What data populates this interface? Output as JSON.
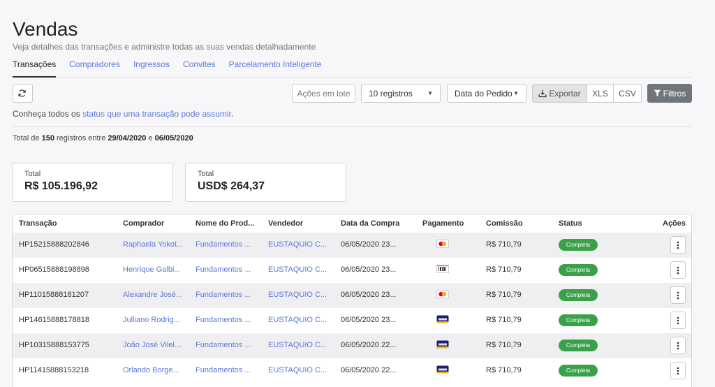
{
  "header": {
    "title": "Vendas",
    "subtitle": "Veja detalhes das transações e administre todas as suas vendas detalhadamente"
  },
  "tabs": [
    {
      "label": "Transações",
      "active": true
    },
    {
      "label": "Compradores",
      "active": false
    },
    {
      "label": "Ingressos",
      "active": false
    },
    {
      "label": "Convites",
      "active": false
    },
    {
      "label": "Parcelamento Inteligente",
      "active": false
    }
  ],
  "toolbar": {
    "refresh_icon": "refresh-icon",
    "lote_label": "Ações em lote",
    "registros_value": "10 registros",
    "data_value": "Data do Pedido",
    "exportar_label": "Exportar",
    "xls_label": "XLS",
    "csv_label": "CSV",
    "filtros_label": "Filtros"
  },
  "status_info": {
    "prefix": "Conheça todos os ",
    "link": "status que uma transação pode assumir",
    "suffix": "."
  },
  "total_info": {
    "p1": "Total de ",
    "count": "150",
    "p2": " registros entre ",
    "start": "29/04/2020",
    "p3": " e ",
    "end": "06/05/2020"
  },
  "cards": {
    "brl": {
      "label": "Total",
      "value": "R$ 105.196,92"
    },
    "usd": {
      "label": "Total",
      "value": "USD$ 264,37"
    }
  },
  "table": {
    "columns": {
      "transacao": "Transação",
      "comprador": "Comprador",
      "produto": "Nome do Prod...",
      "vendedor": "Vendedor",
      "data": "Data da Compra",
      "pagamento": "Pagamento",
      "comissao": "Comissão",
      "status": "Status",
      "acoes": "Ações"
    },
    "rows": [
      {
        "tx": "HP15215888202846",
        "comprador": "Raphaela Yokot...",
        "produto": "Fundamentos ...",
        "vendedor": "EUSTAQUIO C...",
        "data": "06/05/2020 23...",
        "pagamento": "mastercard-icon",
        "comissao": "R$ 710,79",
        "status": "Completa"
      },
      {
        "tx": "HP06515888198898",
        "comprador": "Henrique Galbi...",
        "produto": "Fundamentos ...",
        "vendedor": "EUSTAQUIO C...",
        "data": "06/05/2020 23...",
        "pagamento": "boleto-icon",
        "comissao": "R$ 710,79",
        "status": "Completa"
      },
      {
        "tx": "HP11015888181207",
        "comprador": "Alexandre José...",
        "produto": "Fundamentos ...",
        "vendedor": "EUSTAQUIO C...",
        "data": "06/05/2020 23...",
        "pagamento": "mastercard-icon",
        "comissao": "R$ 710,79",
        "status": "Completa"
      },
      {
        "tx": "HP14615888178818",
        "comprador": "Julliano Rodrig...",
        "produto": "Fundamentos ...",
        "vendedor": "EUSTAQUIO C...",
        "data": "06/05/2020 23...",
        "pagamento": "visa-icon",
        "comissao": "R$ 710,79",
        "status": "Completa"
      },
      {
        "tx": "HP10315888153775",
        "comprador": "João José Vilela...",
        "produto": "Fundamentos ...",
        "vendedor": "EUSTAQUIO C...",
        "data": "06/05/2020 22...",
        "pagamento": "visa-icon",
        "comissao": "R$ 710,79",
        "status": "Completa"
      },
      {
        "tx": "HP11415888153218",
        "comprador": "Orlando Borge...",
        "produto": "Fundamentos ...",
        "vendedor": "EUSTAQUIO C...",
        "data": "06/05/2020 22...",
        "pagamento": "visa-icon",
        "comissao": "R$ 710,79",
        "status": "Completa"
      }
    ]
  },
  "colors": {
    "link": "#5b79d6",
    "status_complete": "#3aa14a",
    "filter_button": "#6f757b"
  }
}
